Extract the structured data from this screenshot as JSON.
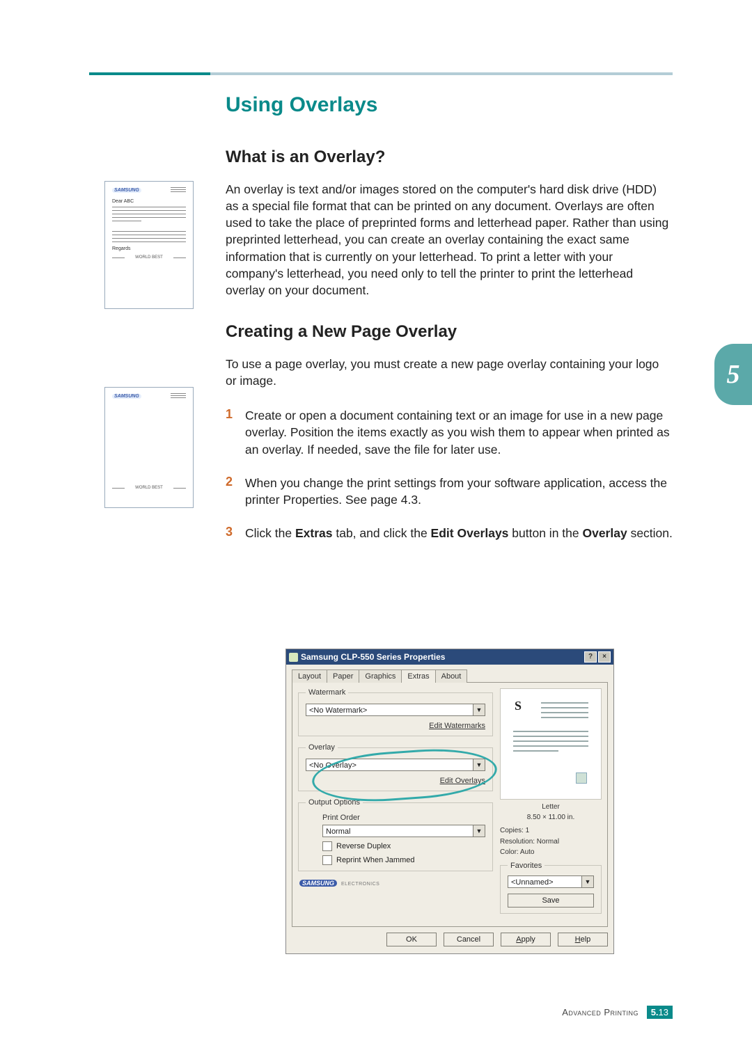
{
  "page": {
    "section_heading": "Using Overlays",
    "h2_a": "What is an Overlay?",
    "para_a": "An overlay is text and/or images stored on the computer's hard disk drive (HDD) as a special file format that can be printed on any document. Overlays are often used to take the place of preprinted forms and letterhead paper. Rather than using preprinted letterhead, you can create an overlay containing the exact same information that is currently on your letterhead. To print a letter with your company's letterhead, you need only to tell the printer to print the letterhead overlay on your document.",
    "h2_b": "Creating a New Page Overlay",
    "para_b": "To use a page overlay, you must create a new page overlay containing your logo or image.",
    "steps": {
      "s1_num": "1",
      "s1_txt": "Create or open a document containing text or an image for use in a new page overlay. Position the items exactly as you wish them to appear when printed as an overlay. If needed, save the file for later use.",
      "s2_num": "2",
      "s2_txt": "When you change the print settings from your software application, access the printer Properties. See page 4.3.",
      "s3_num": "3",
      "s3_pre": "Click the ",
      "s3_b1": "Extras",
      "s3_mid1": " tab, and click the ",
      "s3_b2": "Edit Overlays",
      "s3_mid2": " button in the ",
      "s3_b3": "Overlay",
      "s3_post": " section."
    },
    "chapter_tab": "5"
  },
  "mini": {
    "brand": "SAMSUNG",
    "dear": "Dear ABC",
    "regards": "Regards",
    "foot": "WORLD BEST"
  },
  "dialog": {
    "title": "Samsung CLP-550 Series Properties",
    "help_btn": "?",
    "close_btn": "×",
    "tabs": {
      "t1": "Layout",
      "t2": "Paper",
      "t3": "Graphics",
      "t4": "Extras",
      "t5": "About"
    },
    "watermark": {
      "legend": "Watermark",
      "value": "<No Watermark>",
      "edit": "Edit Watermarks"
    },
    "overlay": {
      "legend": "Overlay",
      "value": "<No Overlay>",
      "edit": "Edit Overlays"
    },
    "output": {
      "legend": "Output Options",
      "order_label": "Print Order",
      "order_value": "Normal",
      "chk1": "Reverse Duplex",
      "chk2": "Reprint When Jammed"
    },
    "preview": {
      "S": "S",
      "paper_name": "Letter",
      "paper_size": "8.50 × 11.00 in."
    },
    "info": {
      "copies": "Copies: 1",
      "resolution": "Resolution: Normal",
      "color": "Color: Auto"
    },
    "favorites": {
      "legend": "Favorites",
      "value": "<Unnamed>",
      "save": "Save"
    },
    "vendor": {
      "logo": "SAMSUNG",
      "sub": "ELECTRONICS"
    },
    "buttons": {
      "ok": "OK",
      "cancel": "Cancel",
      "apply": "Apply",
      "help": "Help",
      "apply_u": "A",
      "help_u": "H"
    }
  },
  "footer": {
    "section": "Advanced Printing",
    "chapter": "5.",
    "page": "13"
  }
}
